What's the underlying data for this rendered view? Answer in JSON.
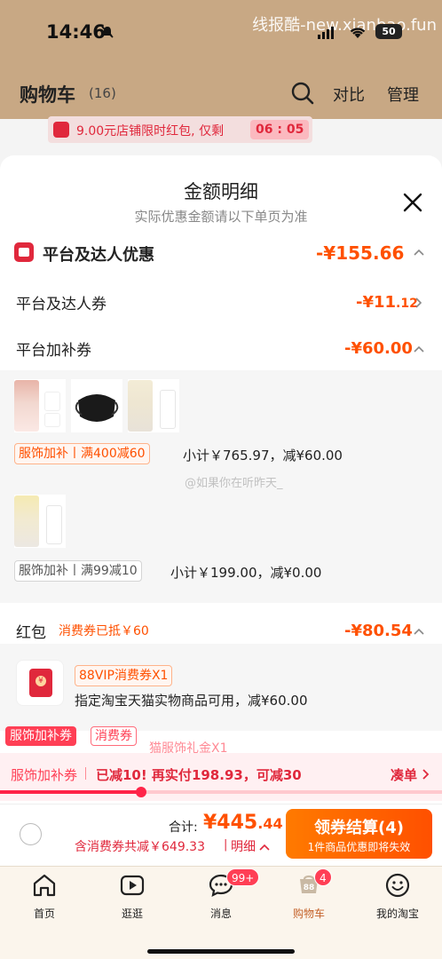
{
  "status_bar": {
    "time": "14:46",
    "battery": "50",
    "watermark": "线报酷-new.xianbao.fun"
  },
  "header": {
    "title": "购物车",
    "count": "(16)",
    "compare": "对比",
    "manage": "管理"
  },
  "promo_banner": {
    "text": "9.00元店铺限时红包, 仅剩",
    "timer": "06 : 05"
  },
  "sheet": {
    "title": "金额明细",
    "subtitle": "实际优惠金额请以下单页为准",
    "platform_total": {
      "label": "平台及达人优惠",
      "value": "-¥155.66"
    },
    "platform_coupon": {
      "label": "平台及达人券",
      "value_main": "-¥11",
      "value_cents": ".12"
    },
    "platform_subsidy": {
      "label": "平台加补券",
      "value": "-¥60.00"
    },
    "group1": {
      "tag": "服饰加补丨满400减60",
      "subtotal": "小计￥765.97，减¥60.00"
    },
    "group2": {
      "tag": "服饰加补丨满99减10",
      "subtotal": "小计￥199.00，减¥0.00"
    },
    "weibo_mark": "@如果你在听昨天_",
    "red_packet": {
      "label": "红包",
      "note": "消费券已抵￥60",
      "value": "-¥80.54"
    },
    "vip_coupon": {
      "tag": "88VIP消费券X1",
      "desc": "指定淘宝天猫实物商品可用，减¥60.00"
    },
    "mini_tags": [
      "服饰加补券",
      "消费券"
    ],
    "clipped_text": "猫服饰礼金X1"
  },
  "progress": {
    "label": "服饰加补券",
    "text": "已减10! 再实付198.93，可减30",
    "link": "凑单",
    "fill_fraction": 0.32
  },
  "checkout": {
    "total_label": "合计:",
    "total_main": "¥445",
    "total_cents": ".44",
    "discount": "含消费券共减￥649.33",
    "detail": "明细",
    "button_label": "领券结算(4)",
    "button_sub": "1件商品优惠即将失效"
  },
  "tabbar": [
    {
      "label": "首页",
      "icon": "home-icon"
    },
    {
      "label": "逛逛",
      "icon": "play-icon"
    },
    {
      "label": "消息",
      "icon": "message-icon",
      "badge": "99+"
    },
    {
      "label": "购物车",
      "icon": "cart-icon",
      "badge": "4"
    },
    {
      "label": "我的淘宝",
      "icon": "profile-icon"
    }
  ],
  "colors": {
    "accent": "#ff5000",
    "red": "#e0283c",
    "header_bg": "#c8a884"
  }
}
